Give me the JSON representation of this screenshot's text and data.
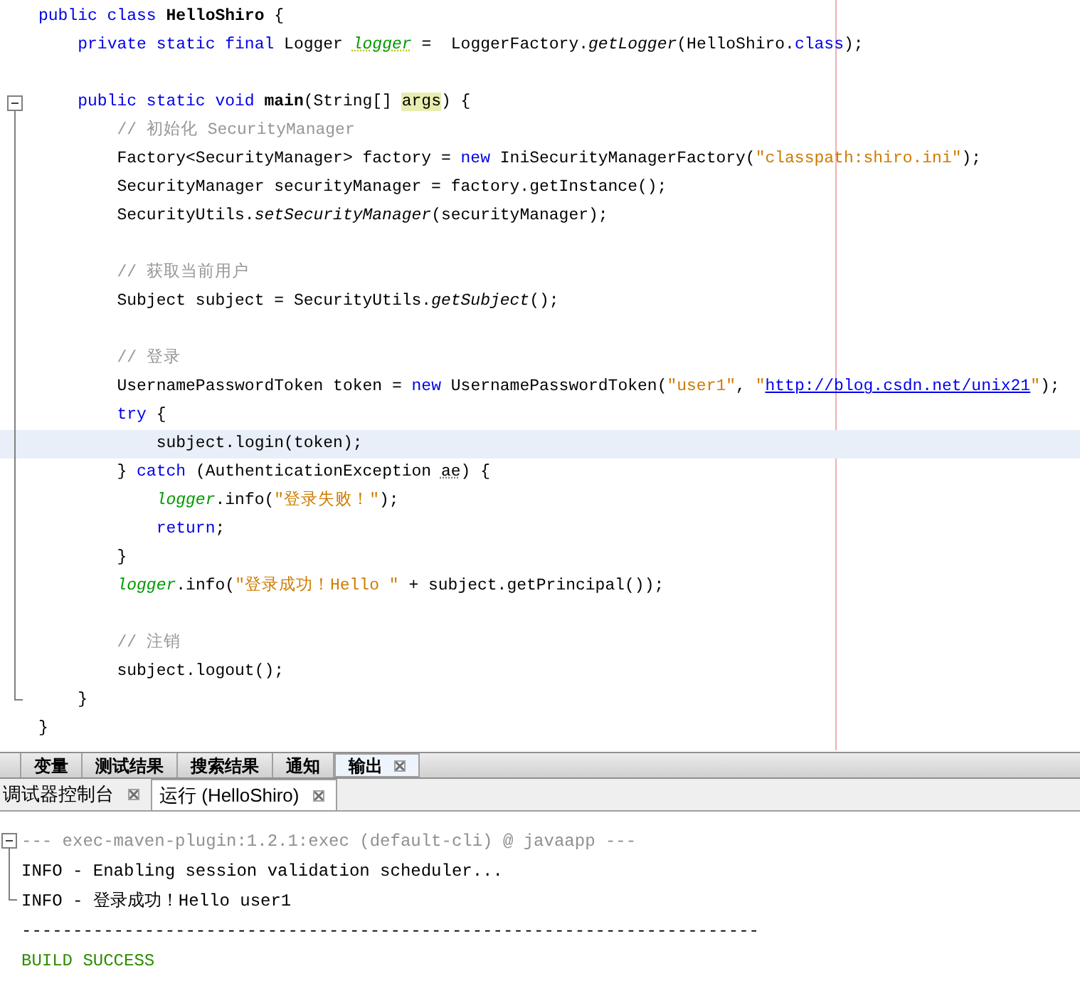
{
  "editor": {
    "lines": [
      {
        "kind": "code",
        "current": false,
        "tokens": [
          {
            "text": "public class ",
            "kind": "keyword"
          },
          {
            "text": "HelloShiro",
            "kind": "bold"
          },
          {
            "text": " {",
            "kind": "plain"
          }
        ]
      },
      {
        "kind": "code",
        "current": false,
        "tokens": [
          {
            "text": "    private static final ",
            "kind": "keyword"
          },
          {
            "text": "Logger ",
            "kind": "plain"
          },
          {
            "text": "logger",
            "kind": "field-warning"
          },
          {
            "text": " =  LoggerFactory.",
            "kind": "plain"
          },
          {
            "text": "getLogger",
            "kind": "italic"
          },
          {
            "text": "(HelloShiro.",
            "kind": "plain"
          },
          {
            "text": "class",
            "kind": "keyword"
          },
          {
            "text": ");",
            "kind": "plain"
          }
        ]
      },
      {
        "kind": "blank",
        "current": false
      },
      {
        "kind": "code",
        "current": false,
        "expanded": true,
        "tokens": [
          {
            "text": "    public static void ",
            "kind": "keyword"
          },
          {
            "text": "main",
            "kind": "bold"
          },
          {
            "text": "(String[] ",
            "kind": "plain"
          },
          {
            "text": "args",
            "kind": "param-mark"
          },
          {
            "text": ") {",
            "kind": "plain"
          }
        ],
        "children": [
          {
            "kind": "code",
            "current": false,
            "tokens": [
              {
                "text": "        // 初始化 SecurityManager",
                "kind": "comment"
              }
            ]
          },
          {
            "kind": "code",
            "current": false,
            "tokens": [
              {
                "text": "        Factory<SecurityManager> factory = ",
                "kind": "plain"
              },
              {
                "text": "new",
                "kind": "keyword"
              },
              {
                "text": " IniSecurityManagerFactory(",
                "kind": "plain"
              },
              {
                "text": "\"classpath:shiro.ini\"",
                "kind": "string"
              },
              {
                "text": ");",
                "kind": "plain"
              }
            ]
          },
          {
            "kind": "code",
            "current": false,
            "tokens": [
              {
                "text": "        SecurityManager securityManager = factory.getInstance();",
                "kind": "plain"
              }
            ]
          },
          {
            "kind": "code",
            "current": false,
            "tokens": [
              {
                "text": "        SecurityUtils.",
                "kind": "plain"
              },
              {
                "text": "setSecurityManager",
                "kind": "italic"
              },
              {
                "text": "(securityManager);",
                "kind": "plain"
              }
            ]
          },
          {
            "kind": "blank",
            "current": false
          },
          {
            "kind": "code",
            "current": false,
            "tokens": [
              {
                "text": "        // 获取当前用户",
                "kind": "comment"
              }
            ]
          },
          {
            "kind": "code",
            "current": false,
            "tokens": [
              {
                "text": "        Subject subject = SecurityUtils.",
                "kind": "plain"
              },
              {
                "text": "getSubject",
                "kind": "italic"
              },
              {
                "text": "();",
                "kind": "plain"
              }
            ]
          },
          {
            "kind": "blank",
            "current": false
          },
          {
            "kind": "code",
            "current": false,
            "tokens": [
              {
                "text": "        // 登录",
                "kind": "comment"
              }
            ]
          },
          {
            "kind": "code",
            "current": false,
            "tokens": [
              {
                "text": "        UsernamePasswordToken token = ",
                "kind": "plain"
              },
              {
                "text": "new",
                "kind": "keyword"
              },
              {
                "text": " UsernamePasswordToken(",
                "kind": "plain"
              },
              {
                "text": "\"user1\"",
                "kind": "string"
              },
              {
                "text": ", ",
                "kind": "plain"
              },
              {
                "text": "\"",
                "kind": "string"
              },
              {
                "text": "http://blog.csdn.net/unix21",
                "kind": "link"
              },
              {
                "text": "\"",
                "kind": "string"
              },
              {
                "text": ");",
                "kind": "plain"
              }
            ]
          },
          {
            "kind": "code",
            "current": false,
            "tokens": [
              {
                "text": "        try",
                "kind": "keyword"
              },
              {
                "text": " {",
                "kind": "plain"
              }
            ]
          },
          {
            "kind": "code",
            "current": true,
            "tokens": [
              {
                "text": "            subject.login(token);",
                "kind": "plain"
              }
            ]
          },
          {
            "kind": "code",
            "current": false,
            "tokens": [
              {
                "text": "        } ",
                "kind": "plain"
              },
              {
                "text": "catch",
                "kind": "keyword"
              },
              {
                "text": " (AuthenticationException ",
                "kind": "plain"
              },
              {
                "text": "ae",
                "kind": "unused"
              },
              {
                "text": ") {",
                "kind": "plain"
              }
            ]
          },
          {
            "kind": "code",
            "current": false,
            "tokens": [
              {
                "text": "            logger",
                "kind": "field"
              },
              {
                "text": ".info(",
                "kind": "plain"
              },
              {
                "text": "\"登录失败！\"",
                "kind": "string"
              },
              {
                "text": ");",
                "kind": "plain"
              }
            ]
          },
          {
            "kind": "code",
            "current": false,
            "tokens": [
              {
                "text": "            return",
                "kind": "keyword"
              },
              {
                "text": ";",
                "kind": "plain"
              }
            ]
          },
          {
            "kind": "code",
            "current": false,
            "tokens": [
              {
                "text": "        }",
                "kind": "plain"
              }
            ]
          },
          {
            "kind": "code",
            "current": false,
            "tokens": [
              {
                "text": "        logger",
                "kind": "field"
              },
              {
                "text": ".info(",
                "kind": "plain"
              },
              {
                "text": "\"登录成功！Hello \"",
                "kind": "string"
              },
              {
                "text": " + subject.getPrincipal());",
                "kind": "plain"
              }
            ]
          },
          {
            "kind": "blank",
            "current": false
          },
          {
            "kind": "code",
            "current": false,
            "tokens": [
              {
                "text": "        // 注销",
                "kind": "comment"
              }
            ]
          },
          {
            "kind": "code",
            "current": false,
            "tokens": [
              {
                "text": "        subject.logout();",
                "kind": "plain"
              }
            ]
          },
          {
            "kind": "code",
            "current": false,
            "tokens": [
              {
                "text": "    }",
                "kind": "plain"
              }
            ]
          }
        ]
      },
      {
        "kind": "code",
        "current": false,
        "tokens": [
          {
            "text": "}",
            "kind": "plain"
          }
        ]
      }
    ]
  },
  "panel_tabs": [
    {
      "label": "变量",
      "selected": false,
      "closable": false
    },
    {
      "label": "测试结果",
      "selected": false,
      "closable": false
    },
    {
      "label": "搜索结果",
      "selected": false,
      "closable": false
    },
    {
      "label": "通知",
      "selected": false,
      "closable": false
    },
    {
      "label": "输出",
      "selected": true,
      "closable": true
    }
  ],
  "output_tabs": [
    {
      "label": "调试器控制台",
      "selected": false
    },
    {
      "label": "运行 (HelloShiro)",
      "selected": true
    }
  ],
  "output": [
    {
      "text": "--- exec-maven-plugin:1.2.1:exec (default-cli) @ javaapp ---",
      "kind": "info",
      "expanded": true,
      "children": [
        {
          "text": "INFO - Enabling session validation scheduler...",
          "kind": "plain"
        },
        {
          "text": "INFO - 登录成功！Hello user1",
          "kind": "plain"
        }
      ]
    },
    {
      "text": "------------------------------------------------------------------------",
      "kind": "plain"
    },
    {
      "text": "BUILD SUCCESS",
      "kind": "success"
    }
  ]
}
